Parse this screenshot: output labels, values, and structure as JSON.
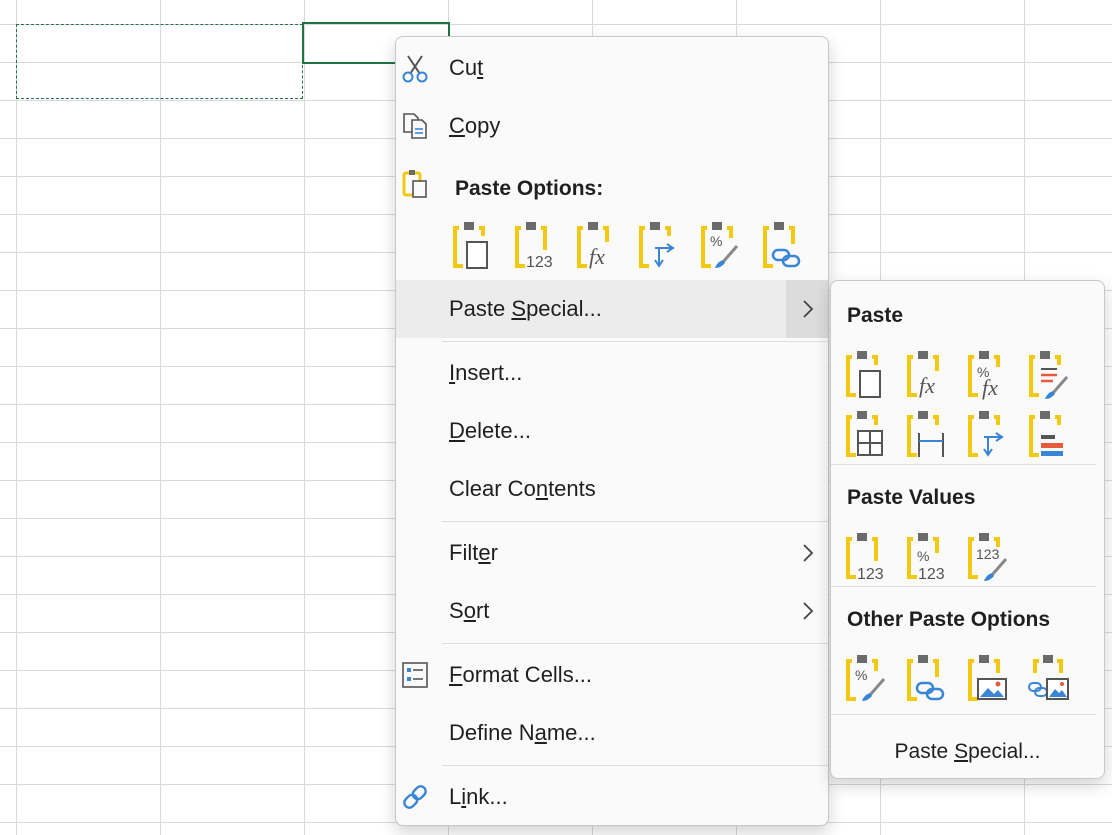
{
  "menu": {
    "cut": {
      "before": "Cu",
      "key": "t",
      "after": "",
      "icon": "scissors-icon"
    },
    "copy": {
      "before": "",
      "key": "C",
      "after": "opy",
      "icon": "copy-icon"
    },
    "paste_options": {
      "title": "Paste Options:",
      "icon": "clipboard-icon",
      "buttons": [
        "paste-icon",
        "paste-values-icon",
        "paste-formulas-icon",
        "paste-transpose-icon",
        "paste-formatting-icon",
        "paste-link-icon"
      ]
    },
    "paste_special": {
      "before": "Paste ",
      "key": "S",
      "after": "pecial..."
    },
    "insert": {
      "before": "",
      "key": "I",
      "after": "nsert..."
    },
    "delete": {
      "before": "",
      "key": "D",
      "after": "elete..."
    },
    "clear_contents": {
      "before": "Clear Co",
      "key": "n",
      "after": "tents"
    },
    "filter": {
      "before": "Filt",
      "key": "e",
      "after": "r"
    },
    "sort": {
      "before": "S",
      "key": "o",
      "after": "rt"
    },
    "format_cells": {
      "before": "",
      "key": "F",
      "after": "ormat Cells...",
      "icon": "format-cells-icon"
    },
    "define_name": {
      "before": "Define N",
      "key": "a",
      "after": "me..."
    },
    "link": {
      "before": "L",
      "key": "i",
      "after": "nk...",
      "icon": "link-icon"
    }
  },
  "submenu": {
    "paste_title": "Paste",
    "paste_values_title": "Paste Values",
    "other_title": "Other Paste Options",
    "footer": {
      "before": "Paste ",
      "key": "S",
      "after": "pecial..."
    },
    "value_labels": {
      "v123": "123",
      "pct": "%",
      "fx": "fx"
    }
  },
  "colors": {
    "clip_yellow": "#f2c811",
    "clip_gray": "#6b6b6b",
    "accent_blue": "#3a86d6",
    "selection_green": "#217346"
  }
}
